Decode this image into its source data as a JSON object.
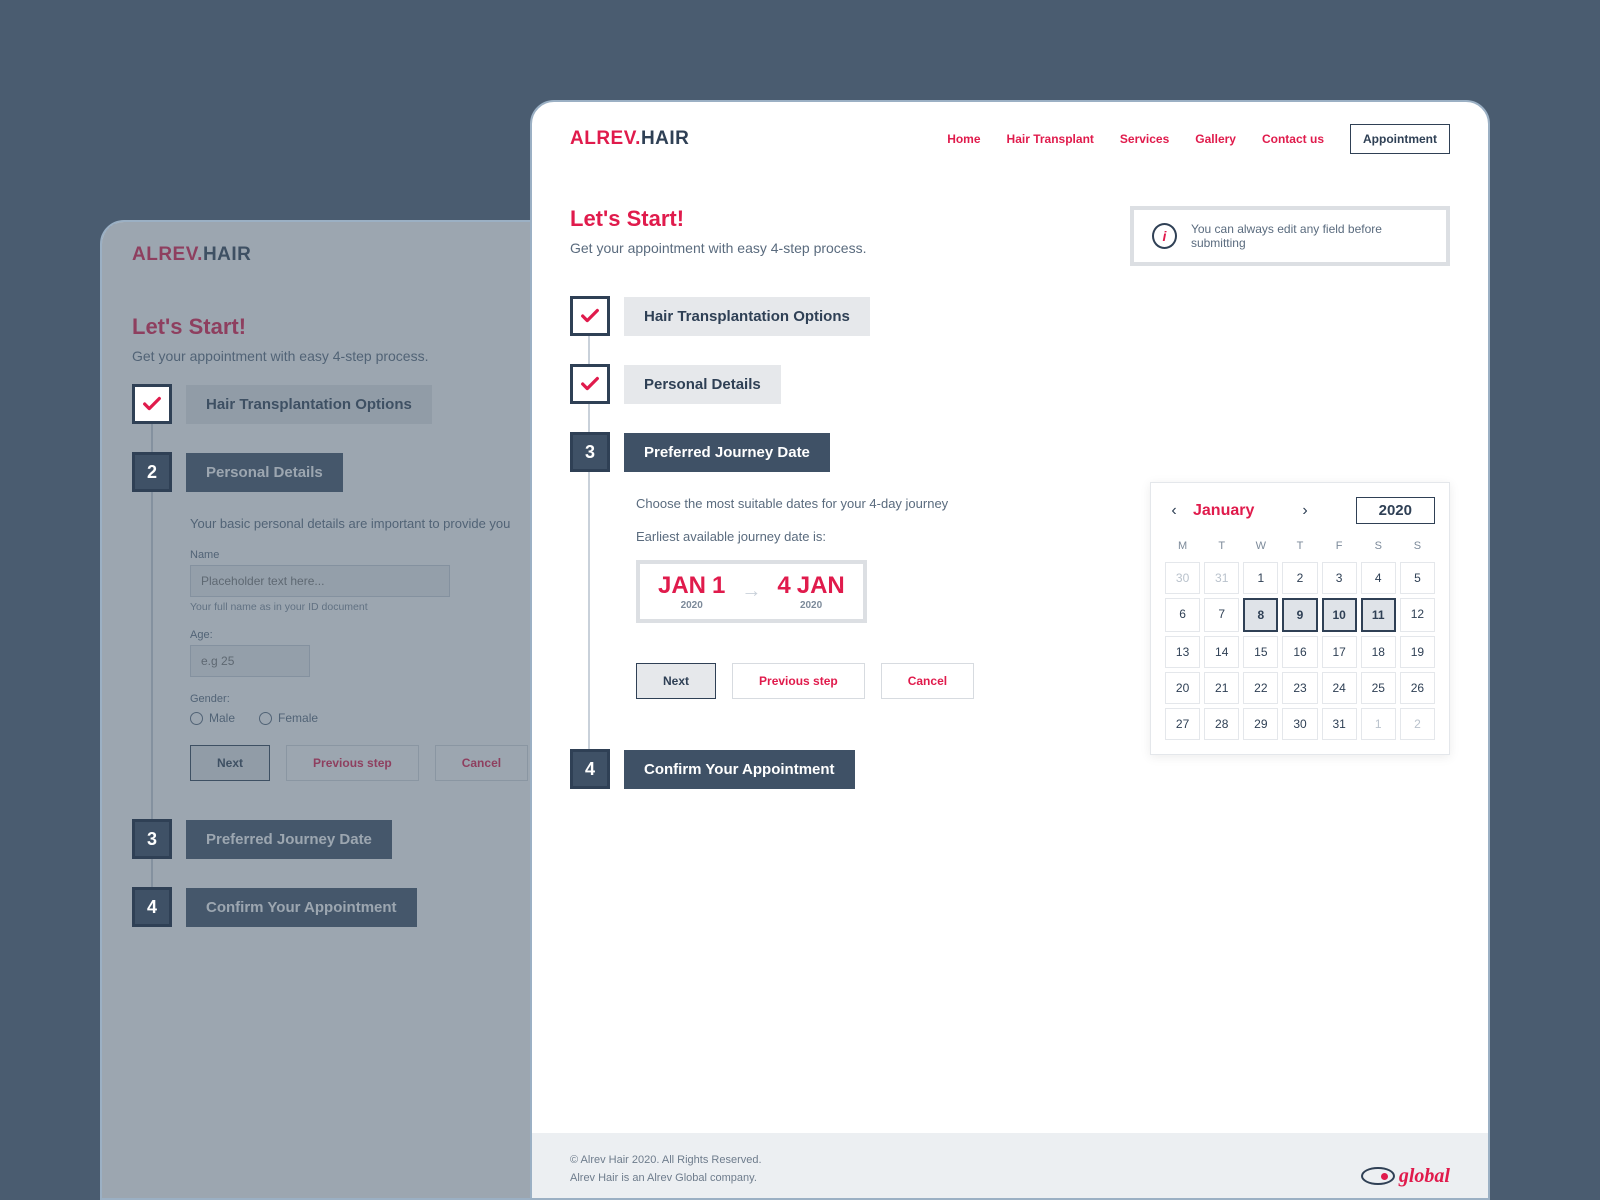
{
  "logo": {
    "part1": "ALREV",
    "dot": ".",
    "part2": "HAIR"
  },
  "nav": {
    "items": [
      "Home",
      "Hair Transplant",
      "Services",
      "Gallery",
      "Contact us"
    ],
    "appointment": "Appointment"
  },
  "intro": {
    "title": "Let's Start!",
    "subtitle": "Get your appointment with easy 4-step process.",
    "info": "You can always edit any field before submitting"
  },
  "steps": {
    "s1": {
      "title": "Hair Transplantation Options"
    },
    "s2": {
      "num": "2",
      "title": "Personal Details",
      "desc": "Your basic personal details are important to provide you",
      "name_label": "Name",
      "name_placeholder": "Placeholder text here...",
      "name_hint": "Your full name as in your ID document",
      "age_label": "Age:",
      "age_placeholder": "e.g 25",
      "gender_label": "Gender:",
      "male": "Male",
      "female": "Female"
    },
    "s3": {
      "num": "3",
      "title": "Preferred Journey Date",
      "desc": "Choose the most suitable dates for your 4-day journey",
      "earliest": "Earliest available journey date is:",
      "from_month": "JAN",
      "from_day": "1",
      "from_year": "2020",
      "to_day": "4",
      "to_month": "JAN",
      "to_year": "2020"
    },
    "s4": {
      "num": "4",
      "title": "Confirm Your Appointment"
    }
  },
  "actions": {
    "next": "Next",
    "prev": "Previous step",
    "cancel": "Cancel"
  },
  "calendar": {
    "month": "January",
    "year": "2020",
    "weekdays": [
      "M",
      "T",
      "W",
      "T",
      "F",
      "S",
      "S"
    ],
    "lead_muted": [
      "30",
      "31"
    ],
    "days": [
      "1",
      "2",
      "3",
      "4",
      "5",
      "6",
      "7",
      "8",
      "9",
      "10",
      "11",
      "12",
      "13",
      "14",
      "15",
      "16",
      "17",
      "18",
      "19",
      "20",
      "21",
      "22",
      "23",
      "24",
      "25",
      "26",
      "27",
      "28",
      "29",
      "30",
      "31"
    ],
    "trail_muted": [
      "1",
      "2"
    ],
    "selected": [
      "8",
      "9",
      "10",
      "11"
    ]
  },
  "footer": {
    "copyright": "© Alrev Hair 2020. All Rights Reserved.",
    "sub": "Alrev Hair is an Alrev Global company.",
    "brand": "global"
  }
}
